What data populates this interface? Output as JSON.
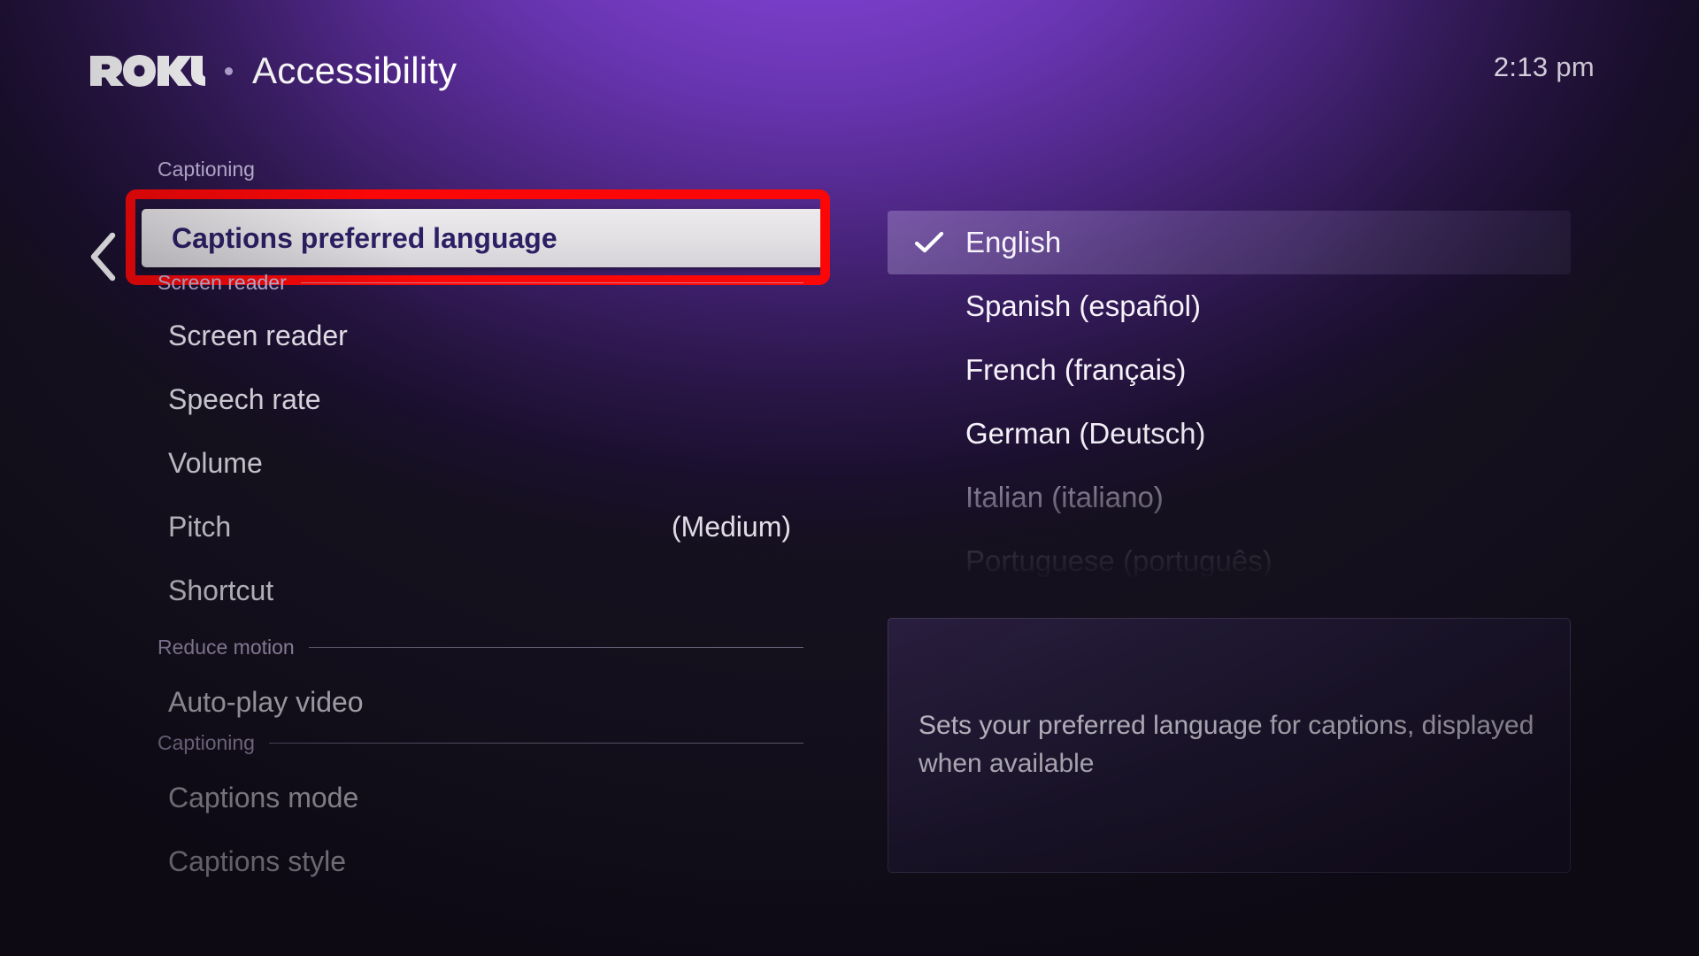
{
  "header": {
    "brand": "Roku",
    "separator_icon": "dot-separator-icon",
    "title": "Accessibility",
    "clock": "2:13 pm"
  },
  "left_menu": {
    "back_icon": "chevron-left-icon",
    "top_section_label": "Captioning",
    "focused_item": "Captions preferred language",
    "sections": [
      {
        "label": "Screen reader",
        "items": [
          {
            "label": "Screen reader",
            "value": ""
          },
          {
            "label": "Speech rate",
            "value": ""
          },
          {
            "label": "Volume",
            "value": ""
          },
          {
            "label": "Pitch",
            "value": "(Medium)"
          },
          {
            "label": "Shortcut",
            "value": ""
          }
        ]
      },
      {
        "label": "Reduce motion",
        "items": [
          {
            "label": "Auto-play video",
            "value": ""
          }
        ]
      },
      {
        "label": "Captioning",
        "items": [
          {
            "label": "Captions mode",
            "value": ""
          },
          {
            "label": "Captions style",
            "value": ""
          }
        ]
      }
    ]
  },
  "right_pane": {
    "check_icon": "checkmark-icon",
    "languages": [
      {
        "label": "English",
        "selected": true,
        "dim": false
      },
      {
        "label": "Spanish (español)",
        "selected": false,
        "dim": false
      },
      {
        "label": "French (français)",
        "selected": false,
        "dim": false
      },
      {
        "label": "German (Deutsch)",
        "selected": false,
        "dim": false
      },
      {
        "label": "Italian (italiano)",
        "selected": false,
        "dim": true
      },
      {
        "label": "Portuguese (português)",
        "selected": false,
        "dim": true
      }
    ],
    "description": "Sets your preferred language for captions, displayed when available"
  },
  "annotation": {
    "highlight_color": "#fb0707",
    "target": "Captions preferred language"
  },
  "colors": {
    "accent_purple": "#7c3fcb",
    "background_dark": "#16121f",
    "focus_text": "#2c1f63",
    "annotation_red": "#fb0707"
  }
}
